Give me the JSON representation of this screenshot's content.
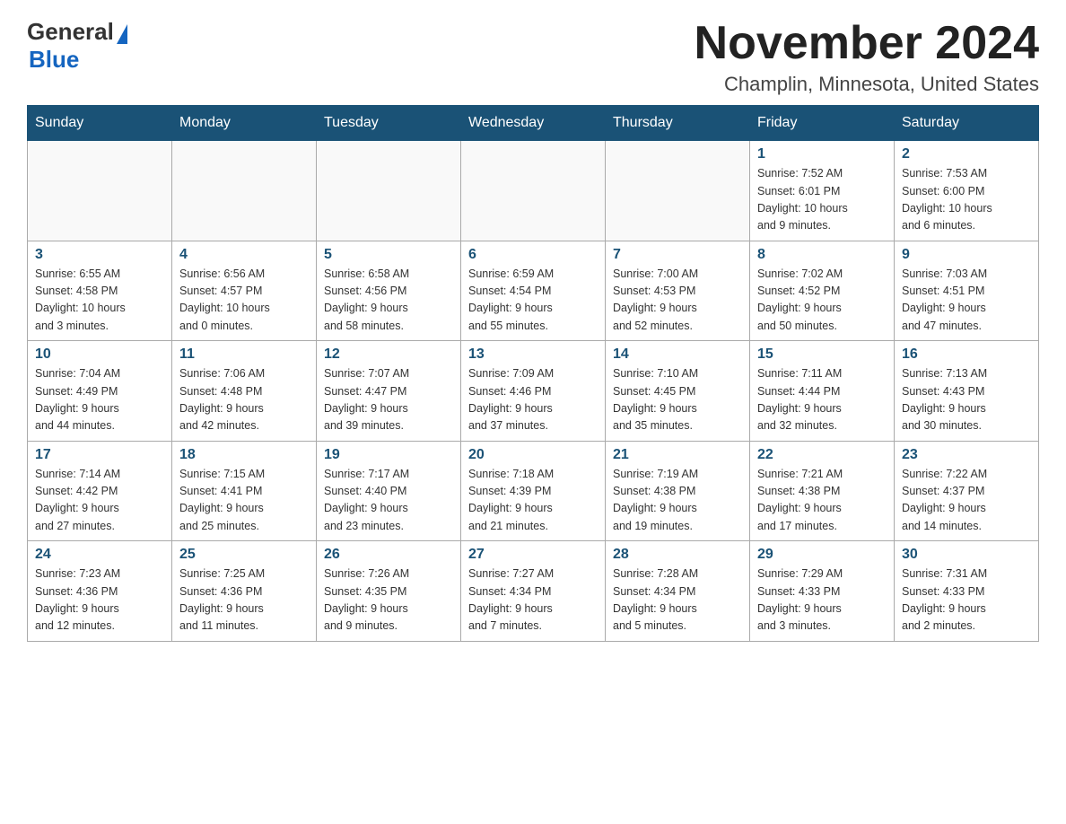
{
  "logo": {
    "general": "General",
    "blue": "Blue"
  },
  "header": {
    "month_year": "November 2024",
    "location": "Champlin, Minnesota, United States"
  },
  "weekdays": [
    "Sunday",
    "Monday",
    "Tuesday",
    "Wednesday",
    "Thursday",
    "Friday",
    "Saturday"
  ],
  "weeks": [
    [
      {
        "day": "",
        "info": ""
      },
      {
        "day": "",
        "info": ""
      },
      {
        "day": "",
        "info": ""
      },
      {
        "day": "",
        "info": ""
      },
      {
        "day": "",
        "info": ""
      },
      {
        "day": "1",
        "info": "Sunrise: 7:52 AM\nSunset: 6:01 PM\nDaylight: 10 hours\nand 9 minutes."
      },
      {
        "day": "2",
        "info": "Sunrise: 7:53 AM\nSunset: 6:00 PM\nDaylight: 10 hours\nand 6 minutes."
      }
    ],
    [
      {
        "day": "3",
        "info": "Sunrise: 6:55 AM\nSunset: 4:58 PM\nDaylight: 10 hours\nand 3 minutes."
      },
      {
        "day": "4",
        "info": "Sunrise: 6:56 AM\nSunset: 4:57 PM\nDaylight: 10 hours\nand 0 minutes."
      },
      {
        "day": "5",
        "info": "Sunrise: 6:58 AM\nSunset: 4:56 PM\nDaylight: 9 hours\nand 58 minutes."
      },
      {
        "day": "6",
        "info": "Sunrise: 6:59 AM\nSunset: 4:54 PM\nDaylight: 9 hours\nand 55 minutes."
      },
      {
        "day": "7",
        "info": "Sunrise: 7:00 AM\nSunset: 4:53 PM\nDaylight: 9 hours\nand 52 minutes."
      },
      {
        "day": "8",
        "info": "Sunrise: 7:02 AM\nSunset: 4:52 PM\nDaylight: 9 hours\nand 50 minutes."
      },
      {
        "day": "9",
        "info": "Sunrise: 7:03 AM\nSunset: 4:51 PM\nDaylight: 9 hours\nand 47 minutes."
      }
    ],
    [
      {
        "day": "10",
        "info": "Sunrise: 7:04 AM\nSunset: 4:49 PM\nDaylight: 9 hours\nand 44 minutes."
      },
      {
        "day": "11",
        "info": "Sunrise: 7:06 AM\nSunset: 4:48 PM\nDaylight: 9 hours\nand 42 minutes."
      },
      {
        "day": "12",
        "info": "Sunrise: 7:07 AM\nSunset: 4:47 PM\nDaylight: 9 hours\nand 39 minutes."
      },
      {
        "day": "13",
        "info": "Sunrise: 7:09 AM\nSunset: 4:46 PM\nDaylight: 9 hours\nand 37 minutes."
      },
      {
        "day": "14",
        "info": "Sunrise: 7:10 AM\nSunset: 4:45 PM\nDaylight: 9 hours\nand 35 minutes."
      },
      {
        "day": "15",
        "info": "Sunrise: 7:11 AM\nSunset: 4:44 PM\nDaylight: 9 hours\nand 32 minutes."
      },
      {
        "day": "16",
        "info": "Sunrise: 7:13 AM\nSunset: 4:43 PM\nDaylight: 9 hours\nand 30 minutes."
      }
    ],
    [
      {
        "day": "17",
        "info": "Sunrise: 7:14 AM\nSunset: 4:42 PM\nDaylight: 9 hours\nand 27 minutes."
      },
      {
        "day": "18",
        "info": "Sunrise: 7:15 AM\nSunset: 4:41 PM\nDaylight: 9 hours\nand 25 minutes."
      },
      {
        "day": "19",
        "info": "Sunrise: 7:17 AM\nSunset: 4:40 PM\nDaylight: 9 hours\nand 23 minutes."
      },
      {
        "day": "20",
        "info": "Sunrise: 7:18 AM\nSunset: 4:39 PM\nDaylight: 9 hours\nand 21 minutes."
      },
      {
        "day": "21",
        "info": "Sunrise: 7:19 AM\nSunset: 4:38 PM\nDaylight: 9 hours\nand 19 minutes."
      },
      {
        "day": "22",
        "info": "Sunrise: 7:21 AM\nSunset: 4:38 PM\nDaylight: 9 hours\nand 17 minutes."
      },
      {
        "day": "23",
        "info": "Sunrise: 7:22 AM\nSunset: 4:37 PM\nDaylight: 9 hours\nand 14 minutes."
      }
    ],
    [
      {
        "day": "24",
        "info": "Sunrise: 7:23 AM\nSunset: 4:36 PM\nDaylight: 9 hours\nand 12 minutes."
      },
      {
        "day": "25",
        "info": "Sunrise: 7:25 AM\nSunset: 4:36 PM\nDaylight: 9 hours\nand 11 minutes."
      },
      {
        "day": "26",
        "info": "Sunrise: 7:26 AM\nSunset: 4:35 PM\nDaylight: 9 hours\nand 9 minutes."
      },
      {
        "day": "27",
        "info": "Sunrise: 7:27 AM\nSunset: 4:34 PM\nDaylight: 9 hours\nand 7 minutes."
      },
      {
        "day": "28",
        "info": "Sunrise: 7:28 AM\nSunset: 4:34 PM\nDaylight: 9 hours\nand 5 minutes."
      },
      {
        "day": "29",
        "info": "Sunrise: 7:29 AM\nSunset: 4:33 PM\nDaylight: 9 hours\nand 3 minutes."
      },
      {
        "day": "30",
        "info": "Sunrise: 7:31 AM\nSunset: 4:33 PM\nDaylight: 9 hours\nand 2 minutes."
      }
    ]
  ]
}
